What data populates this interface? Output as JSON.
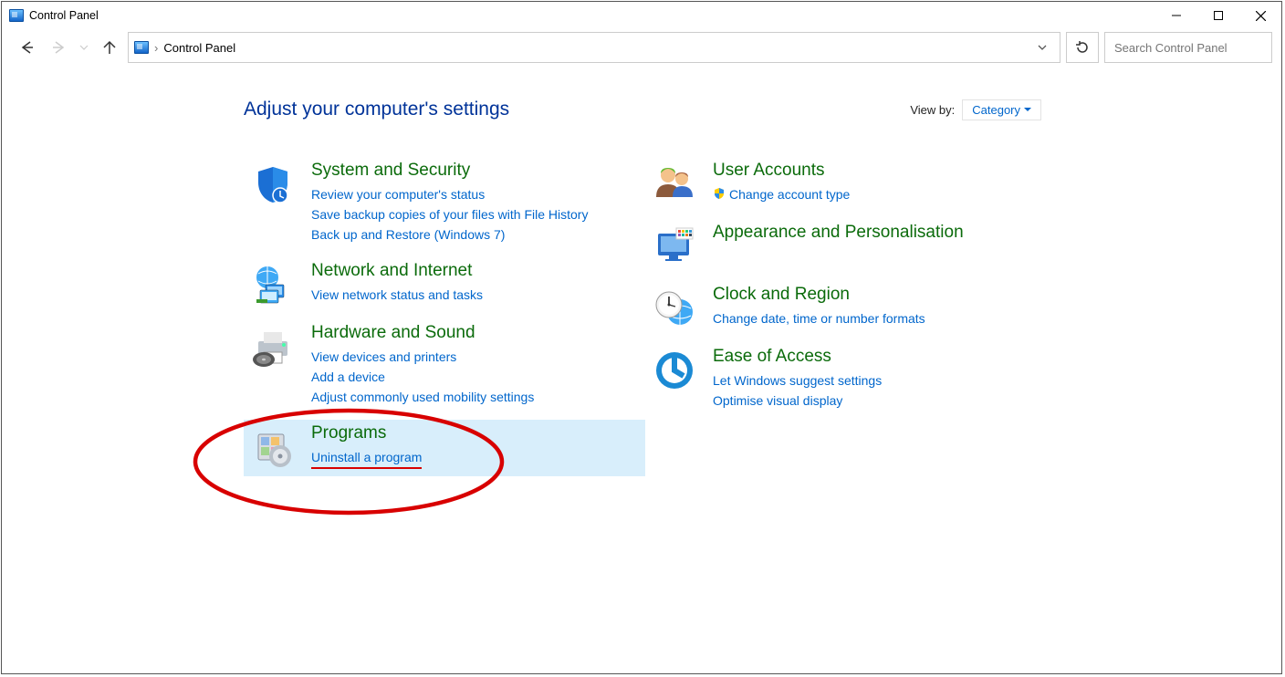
{
  "window": {
    "title": "Control Panel"
  },
  "nav": {
    "breadcrumb": "Control Panel",
    "search_placeholder": "Search Control Panel"
  },
  "page": {
    "heading": "Adjust your computer's settings",
    "viewby_label": "View by:",
    "viewby_value": "Category"
  },
  "categories": {
    "left": [
      {
        "title": "System and Security",
        "links": [
          "Review your computer's status",
          "Save backup copies of your files with File History",
          "Back up and Restore (Windows 7)"
        ]
      },
      {
        "title": "Network and Internet",
        "links": [
          "View network status and tasks"
        ]
      },
      {
        "title": "Hardware and Sound",
        "links": [
          "View devices and printers",
          "Add a device",
          "Adjust commonly used mobility settings"
        ]
      },
      {
        "title": "Programs",
        "links": [
          "Uninstall a program"
        ],
        "highlighted": true
      }
    ],
    "right": [
      {
        "title": "User Accounts",
        "links": [
          "Change account type"
        ],
        "shield_on_first": true
      },
      {
        "title": "Appearance and Personalisation",
        "links": []
      },
      {
        "title": "Clock and Region",
        "links": [
          "Change date, time or number formats"
        ]
      },
      {
        "title": "Ease of Access",
        "links": [
          "Let Windows suggest settings",
          "Optimise visual display"
        ]
      }
    ]
  },
  "annotation": {
    "circled_item": "Programs / Uninstall a program"
  }
}
